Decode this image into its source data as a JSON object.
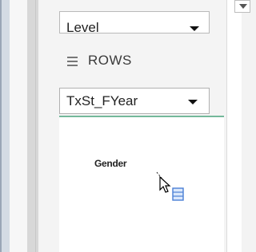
{
  "filter_dropdown": {
    "value": "Level"
  },
  "rows_section": {
    "title": "ROWS",
    "field_dropdown": {
      "value": "TxSt_FYear"
    }
  },
  "drag": {
    "field_label": "Gender"
  },
  "icons": [
    "rows-list-icon",
    "dropdown-caret-icon",
    "scroll-down-icon",
    "drag-move-cursor-icon"
  ],
  "colors": {
    "drop_indicator": "#74b89a",
    "accent": "#4a7fd6"
  }
}
